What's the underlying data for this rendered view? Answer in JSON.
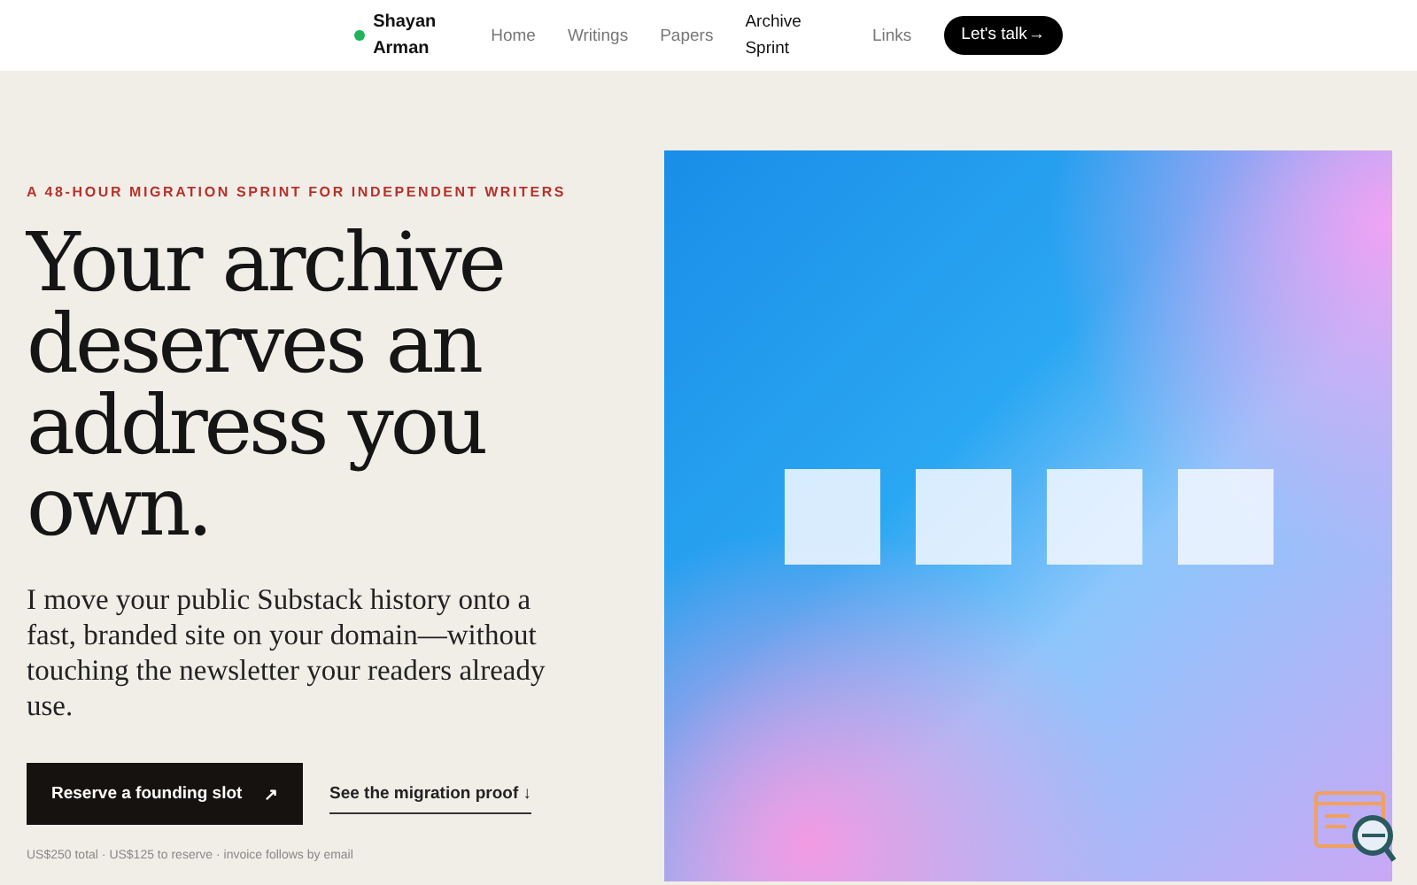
{
  "nav": {
    "brand": "Shayan Arman",
    "links": [
      {
        "label": "Home",
        "selected": false
      },
      {
        "label": "Writings",
        "selected": false
      },
      {
        "label": "Papers",
        "selected": false
      },
      {
        "label": "Archive Sprint",
        "selected": true
      },
      {
        "label": "Links",
        "selected": false
      }
    ],
    "cta": {
      "label": "Let's talk",
      "icon": "→"
    }
  },
  "hero": {
    "eyebrow": "A 48-HOUR MIGRATION SPRINT FOR INDEPENDENT WRITERS",
    "title": "Your archive deserves an address you own.",
    "lede": "I move your public Substack history onto a fast, branded site on your domain—without touching the newsletter your readers already use.",
    "primary": {
      "label": "Reserve a founding slot",
      "icon": "↗"
    },
    "secondary": {
      "label": "See the migration proof",
      "icon": "↓"
    },
    "note": "US$250 total · US$125 to reserve · invoice follows by email"
  }
}
